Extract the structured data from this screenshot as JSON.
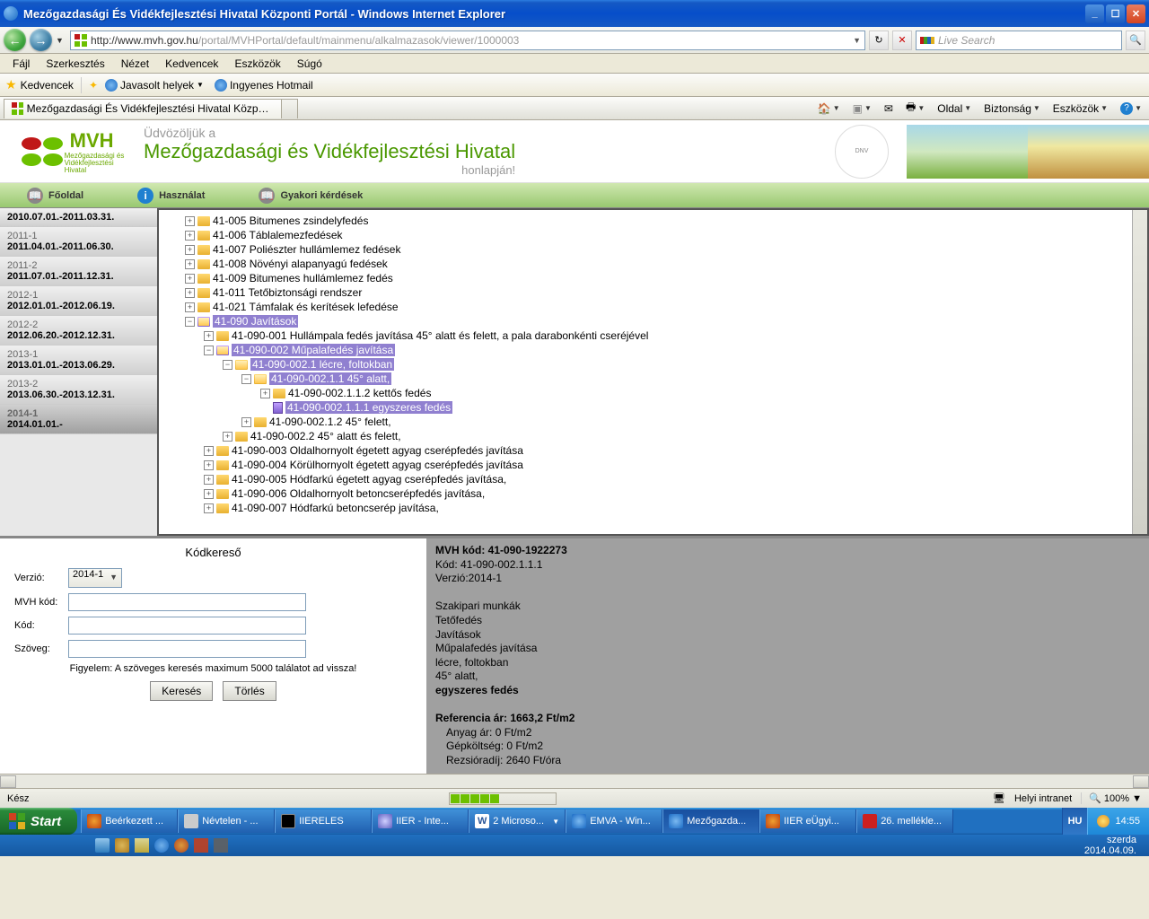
{
  "window": {
    "title": "Mezőgazdasági És Vidékfejlesztési Hivatal Központi Portál - Windows Internet Explorer",
    "url_host": "http://www.mvh.gov.hu",
    "url_path": "/portal/MVHPortal/default/mainmenu/alkalmazasok/viewer/1000003",
    "search_placeholder": "Live Search"
  },
  "menu": [
    "Fájl",
    "Szerkesztés",
    "Nézet",
    "Kedvencek",
    "Eszközök",
    "Súgó"
  ],
  "favbar": {
    "label": "Kedvencek",
    "suggested": "Javasolt helyek",
    "hotmail": "Ingyenes Hotmail"
  },
  "tab": {
    "title": "Mezőgazdasági És Vidékfejlesztési Hivatal Központi Po..."
  },
  "toolbar": {
    "page": "Oldal",
    "safety": "Biztonság",
    "tools": "Eszközök"
  },
  "mvh": {
    "logo": "MVH",
    "logo_sub1": "Mezőgazdasági és",
    "logo_sub2": "Vidékfejlesztési",
    "logo_sub3": "Hivatal",
    "welcome": "Üdvözöljük a",
    "title": "Mezőgazdasági és Vidékfejlesztési Hivatal",
    "subtitle": "honlapján!"
  },
  "nav": {
    "home": "Főoldal",
    "usage": "Használat",
    "faq": "Gyakori kérdések"
  },
  "periods": [
    {
      "title": "",
      "date": "2010.07.01.-2011.03.31."
    },
    {
      "title": "2011-1",
      "date": "2011.04.01.-2011.06.30."
    },
    {
      "title": "2011-2",
      "date": "2011.07.01.-2011.12.31."
    },
    {
      "title": "2012-1",
      "date": "2012.01.01.-2012.06.19."
    },
    {
      "title": "2012-2",
      "date": "2012.06.20.-2012.12.31."
    },
    {
      "title": "2013-1",
      "date": "2013.01.01.-2013.06.29."
    },
    {
      "title": "2013-2",
      "date": "2013.06.30.-2013.12.31."
    },
    {
      "title": "2014-1",
      "date": "2014.01.01.-"
    }
  ],
  "tree": {
    "n41005": "41-005 Bitumenes zsindelyfedés",
    "n41006": "41-006 Táblalemezfedések",
    "n41007": "41-007 Poliészter hullámlemez fedések",
    "n41008": "41-008 Növényi alapanyagú fedések",
    "n41009": "41-009 Bitumenes hullámlemez fedés",
    "n41011": "41-011 Tetőbiztonsági rendszer",
    "n41021": "41-021 Támfalak és kerítések lefedése",
    "n41090": "41-090 Javítások",
    "n41090001": "41-090-001 Hullámpala fedés javítása 45° alatt és felett, a pala darabonkénti cseréjével",
    "n41090002": "41-090-002 Műpalafedés javítása",
    "n410900021": "41-090-002.1 lécre, foltokban",
    "n4109000211": "41-090-002.1.1 45° alatt,",
    "n41090002112": "41-090-002.1.1.2 kettős fedés",
    "n41090002111": "41-090-002.1.1.1 egyszeres fedés",
    "n4109000212": "41-090-002.1.2 45° felett,",
    "n410900022": "41-090-002.2 45° alatt és felett,",
    "n41090003": "41-090-003 Oldalhornyolt égetett agyag cserépfedés javítása",
    "n41090004": "41-090-004 Körülhornyolt égetett agyag cserépfedés javítása",
    "n41090005": "41-090-005 Hódfarkú égetett agyag cserépfedés javítása,",
    "n41090006": "41-090-006 Oldalhornyolt betoncserépfedés javítása,",
    "n41090007": "41-090-007 Hódfarkú betoncserép javítása,"
  },
  "search": {
    "title": "Kódkereső",
    "version_label": "Verzió:",
    "version_value": "2014-1",
    "mvh_label": "MVH kód:",
    "code_label": "Kód:",
    "text_label": "Szöveg:",
    "warning": "Figyelem: A szöveges keresés maximum 5000 találatot ad vissza!",
    "search_btn": "Keresés",
    "clear_btn": "Törlés"
  },
  "detail": {
    "l1": "MVH kód: 41-090-1922273",
    "l2": "Kód: 41-090-002.1.1.1",
    "l3": "Verzió:2014-1",
    "l4": "Szakipari munkák",
    "l5": "Tetőfedés",
    "l6": "Javítások",
    "l7": "Műpalafedés javítása",
    "l8": "lécre, foltokban",
    "l9": "45° alatt,",
    "l10": "egyszeres fedés",
    "l11": "Referencia ár: 1663,2 Ft/m2",
    "l12": "Anyag ár: 0 Ft/m2",
    "l13": "Gépköltség: 0 Ft/m2",
    "l14": "Rezsióradíj: 2640 Ft/óra"
  },
  "status": {
    "ready": "Kész",
    "intranet": "Helyi intranet",
    "zoom": "100%"
  },
  "taskbar": {
    "start": "Start",
    "items": [
      "Beérkezett ...",
      "Névtelen - ...",
      "IIERELES",
      "IIER - Inte...",
      "2 Microso...",
      "EMVA - Win...",
      "Mezőgazda...",
      "IIER eÜgyi...",
      "26. mellékle..."
    ],
    "lang": "HU",
    "time": "14:55",
    "day": "szerda",
    "date": "2014.04.09."
  }
}
